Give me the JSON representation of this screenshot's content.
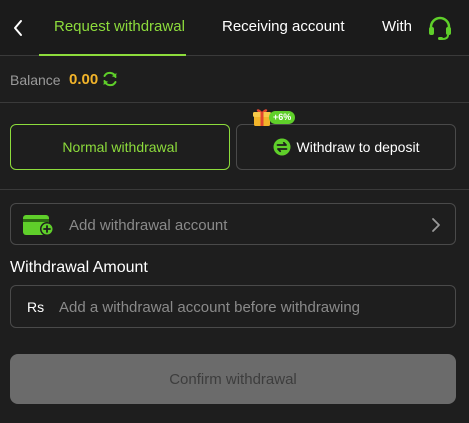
{
  "header": {
    "tabs": [
      {
        "label": "Request withdrawal",
        "active": true
      },
      {
        "label": "Receiving account",
        "active": false
      },
      {
        "label": "With",
        "active": false
      }
    ],
    "back_icon": "chevron-left-icon",
    "support_icon": "headset-icon"
  },
  "balance": {
    "label": "Balance",
    "value": "0.00",
    "refresh_icon": "refresh-icon"
  },
  "modes": {
    "normal_label": "Normal withdrawal",
    "deposit_label": "Withdraw to deposit",
    "bonus_badge": "+6%",
    "selected": "normal"
  },
  "account": {
    "add_label": "Add withdrawal account"
  },
  "amount": {
    "label": "Withdrawal Amount",
    "currency": "Rs",
    "placeholder": "Add a withdrawal account before withdrawing",
    "value": ""
  },
  "confirm": {
    "label": "Confirm withdrawal"
  },
  "colors": {
    "accent": "#8ddc3c",
    "balance": "#f2b42a",
    "background": "#1e1e1e",
    "border": "#4a4a4a"
  }
}
